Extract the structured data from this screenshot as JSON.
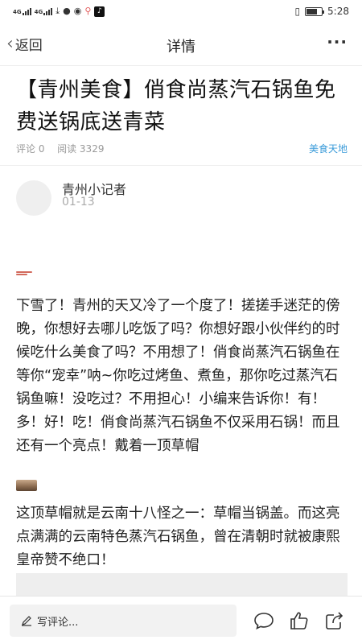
{
  "status_bar": {
    "signal1": "4G",
    "signal2": "4G",
    "time": "5:28"
  },
  "nav": {
    "back_label": "返回",
    "title": "详情"
  },
  "article": {
    "title": "【青州美食】俏食尚蒸汽石锅鱼免费送锅底送青菜",
    "comments": "评论 0",
    "reads": "阅读 3329",
    "category": "美食天地",
    "author": "青州小记者",
    "date": "01-13",
    "paragraph1": "下雪了！青州的天又冷了一个度了！搓搓手迷茫的傍晚，你想好去哪儿吃饭了吗？你想好跟小伙伴约的时候吃什么美食了吗？不用想了！俏食尚蒸汽石锅鱼在等你“宠幸”呐~你吃过烤鱼、煮鱼，那你吃过蒸汽石锅鱼嘛！没吃过？不用担心！小编来告诉你！有！多！好！吃！俏食尚蒸汽石锅鱼不仅采用石锅！而且还有一个亮点！戴着一顶草帽",
    "paragraph2": "这顶草帽就是云南十八怪之一：草帽当锅盖。而这亮点满满的云南特色蒸汽石锅鱼，曾在清朝时就被康熙皇帝赞不绝口！"
  },
  "bottom_bar": {
    "comment_placeholder": "写评论..."
  },
  "colors": {
    "accent": "#3a9bd9",
    "text": "#222222",
    "muted": "#999999"
  }
}
